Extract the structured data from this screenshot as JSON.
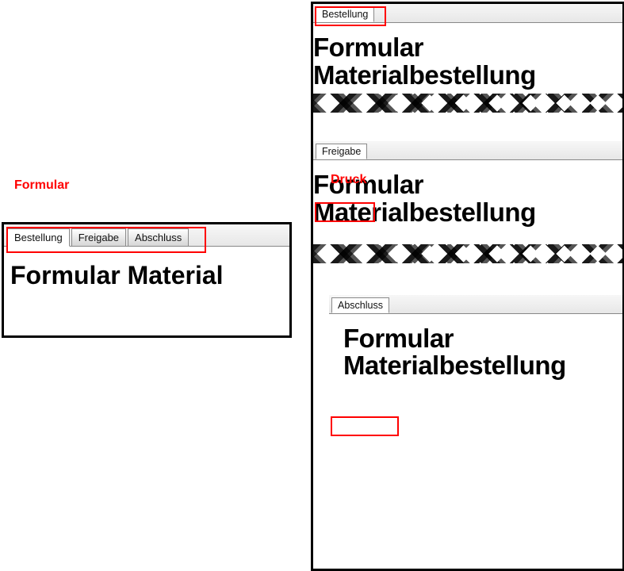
{
  "labels": {
    "formular": "Formular",
    "druck": "Druck"
  },
  "left": {
    "tabs": [
      {
        "label": "Bestellung"
      },
      {
        "label": "Freigabe"
      },
      {
        "label": "Abschluss"
      }
    ],
    "heading": "Formular Material"
  },
  "right": {
    "sections": [
      {
        "tab": "Bestellung",
        "title_l1": "Formular",
        "title_l2": "Materialbestellung"
      },
      {
        "tab": "Freigabe",
        "title_l1": "Formular",
        "title_l2": "Materialbestellung"
      },
      {
        "tab": "Abschluss",
        "title_l1": "Formular",
        "title_l2": "Materialbestellung"
      }
    ]
  }
}
